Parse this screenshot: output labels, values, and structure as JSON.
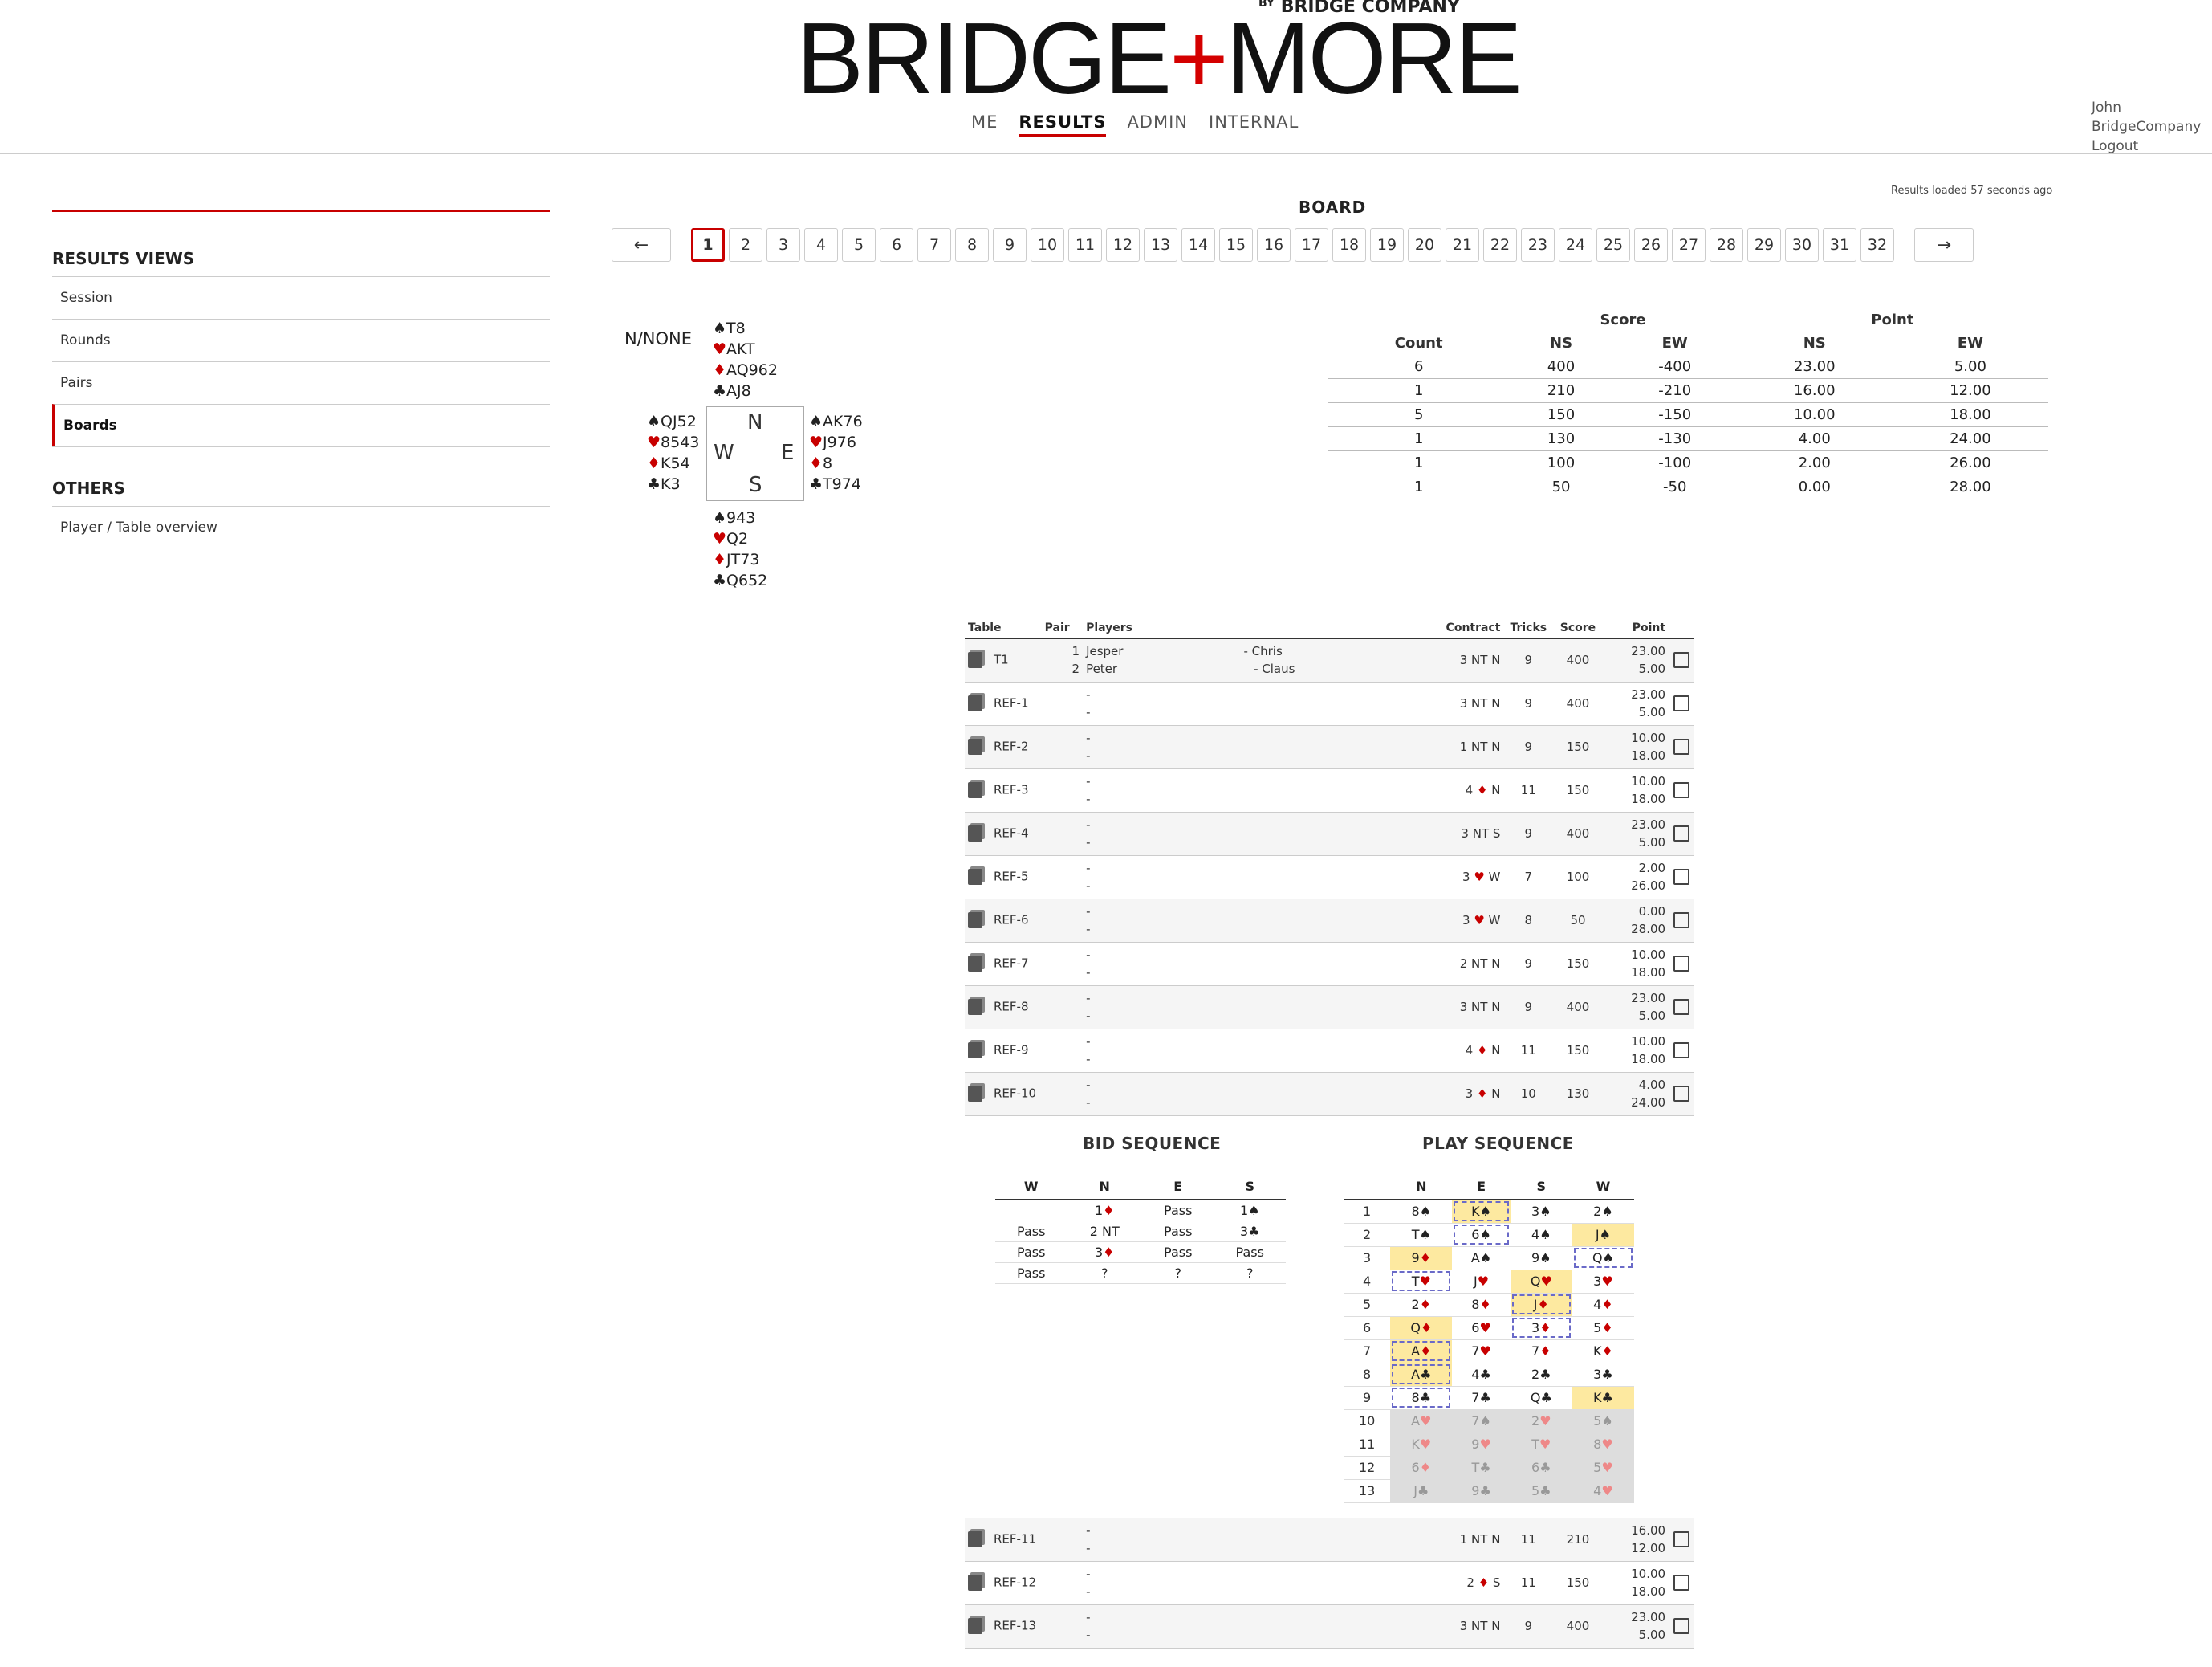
{
  "logo": {
    "text1": "BRIDGE",
    "plus": "+",
    "text2": "MORE",
    "by": "BY",
    "company": "BRIDGE COMPANY"
  },
  "nav": [
    "ME",
    "RESULTS",
    "ADMIN",
    "INTERNAL"
  ],
  "user": {
    "name": "John",
    "org": "BridgeCompany",
    "logout": "Logout"
  },
  "sidebar": {
    "results_title": "RESULTS VIEWS",
    "items": [
      "Session",
      "Rounds",
      "Pairs",
      "Boards"
    ],
    "others_title": "OTHERS",
    "others": [
      "Player / Table overview"
    ]
  },
  "loaded": "Results loaded 57 seconds ago",
  "board_title": "BOARD",
  "pager": {
    "prev": "←",
    "next": "→",
    "pages": [
      "1",
      "2",
      "3",
      "4",
      "5",
      "6",
      "7",
      "8",
      "9",
      "10",
      "11",
      "12",
      "13",
      "14",
      "15",
      "16",
      "17",
      "18",
      "19",
      "20",
      "21",
      "22",
      "23",
      "24",
      "25",
      "26",
      "27",
      "28",
      "29",
      "30",
      "31",
      "32"
    ]
  },
  "deal": {
    "dealer_vul": "N/NONE",
    "north": [
      "T8",
      "AKT",
      "AQ962",
      "AJ8"
    ],
    "west": [
      "QJ52",
      "8543",
      "K54",
      "K3"
    ],
    "east": [
      "AK76",
      "J976",
      "8",
      "T974"
    ],
    "south": [
      "943",
      "Q2",
      "JT73",
      "Q652"
    ],
    "compass": {
      "n": "N",
      "w": "W",
      "e": "E",
      "s": "S"
    }
  },
  "score_table": {
    "groups": [
      "Score",
      "Point"
    ],
    "headers": [
      "Count",
      "NS",
      "EW",
      "NS",
      "EW"
    ],
    "rows": [
      [
        "6",
        "400",
        "-400",
        "23.00",
        "5.00"
      ],
      [
        "1",
        "210",
        "-210",
        "16.00",
        "12.00"
      ],
      [
        "5",
        "150",
        "-150",
        "10.00",
        "18.00"
      ],
      [
        "1",
        "130",
        "-130",
        "4.00",
        "24.00"
      ],
      [
        "1",
        "100",
        "-100",
        "2.00",
        "26.00"
      ],
      [
        "1",
        "50",
        "-50",
        "0.00",
        "28.00"
      ]
    ]
  },
  "results": {
    "headers": [
      "Table",
      "Pair",
      "Players",
      "Contract",
      "Tricks",
      "Score",
      "Point"
    ],
    "rows": [
      {
        "table": "T1",
        "pair1": "1",
        "pair2": "2",
        "p1": "Jesper",
        "p1b": "- Chris",
        "p2": "Peter",
        "p2b": "- Claus",
        "level": "3",
        "suit": "NT",
        "decl": "N",
        "tricks": "9",
        "score": "400",
        "pt1": "23.00",
        "pt2": "5.00"
      },
      {
        "table": "REF-1",
        "pair1": "",
        "pair2": "",
        "p1": "-",
        "p1b": "",
        "p2": "-",
        "p2b": "",
        "level": "3",
        "suit": "NT",
        "decl": "N",
        "tricks": "9",
        "score": "400",
        "pt1": "23.00",
        "pt2": "5.00"
      },
      {
        "table": "REF-2",
        "pair1": "",
        "pair2": "",
        "p1": "-",
        "p1b": "",
        "p2": "-",
        "p2b": "",
        "level": "1",
        "suit": "NT",
        "decl": "N",
        "tricks": "9",
        "score": "150",
        "pt1": "10.00",
        "pt2": "18.00"
      },
      {
        "table": "REF-3",
        "pair1": "",
        "pair2": "",
        "p1": "-",
        "p1b": "",
        "p2": "-",
        "p2b": "",
        "level": "4",
        "suit": "♦",
        "decl": "N",
        "tricks": "11",
        "score": "150",
        "pt1": "10.00",
        "pt2": "18.00"
      },
      {
        "table": "REF-4",
        "pair1": "",
        "pair2": "",
        "p1": "-",
        "p1b": "",
        "p2": "-",
        "p2b": "",
        "level": "3",
        "suit": "NT",
        "decl": "S",
        "tricks": "9",
        "score": "400",
        "pt1": "23.00",
        "pt2": "5.00"
      },
      {
        "table": "REF-5",
        "pair1": "",
        "pair2": "",
        "p1": "-",
        "p1b": "",
        "p2": "-",
        "p2b": "",
        "level": "3",
        "suit": "♥",
        "decl": "W",
        "tricks": "7",
        "score": "100",
        "pt1": "2.00",
        "pt2": "26.00"
      },
      {
        "table": "REF-6",
        "pair1": "",
        "pair2": "",
        "p1": "-",
        "p1b": "",
        "p2": "-",
        "p2b": "",
        "level": "3",
        "suit": "♥",
        "decl": "W",
        "tricks": "8",
        "score": "50",
        "pt1": "0.00",
        "pt2": "28.00"
      },
      {
        "table": "REF-7",
        "pair1": "",
        "pair2": "",
        "p1": "-",
        "p1b": "",
        "p2": "-",
        "p2b": "",
        "level": "2",
        "suit": "NT",
        "decl": "N",
        "tricks": "9",
        "score": "150",
        "pt1": "10.00",
        "pt2": "18.00"
      },
      {
        "table": "REF-8",
        "pair1": "",
        "pair2": "",
        "p1": "-",
        "p1b": "",
        "p2": "-",
        "p2b": "",
        "level": "3",
        "suit": "NT",
        "decl": "N",
        "tricks": "9",
        "score": "400",
        "pt1": "23.00",
        "pt2": "5.00"
      },
      {
        "table": "REF-9",
        "pair1": "",
        "pair2": "",
        "p1": "-",
        "p1b": "",
        "p2": "-",
        "p2b": "",
        "level": "4",
        "suit": "♦",
        "decl": "N",
        "tricks": "11",
        "score": "150",
        "pt1": "10.00",
        "pt2": "18.00"
      },
      {
        "table": "REF-10",
        "pair1": "",
        "pair2": "",
        "p1": "-",
        "p1b": "",
        "p2": "-",
        "p2b": "",
        "level": "3",
        "suit": "♦",
        "decl": "N",
        "tricks": "10",
        "score": "130",
        "pt1": "4.00",
        "pt2": "24.00"
      }
    ],
    "rows_after": [
      {
        "table": "REF-11",
        "pair1": "",
        "pair2": "",
        "p1": "-",
        "p1b": "",
        "p2": "-",
        "p2b": "",
        "level": "1",
        "suit": "NT",
        "decl": "N",
        "tricks": "11",
        "score": "210",
        "pt1": "16.00",
        "pt2": "12.00"
      },
      {
        "table": "REF-12",
        "pair1": "",
        "pair2": "",
        "p1": "-",
        "p1b": "",
        "p2": "-",
        "p2b": "",
        "level": "2",
        "suit": "♦",
        "decl": "S",
        "tricks": "11",
        "score": "150",
        "pt1": "10.00",
        "pt2": "18.00"
      },
      {
        "table": "REF-13",
        "pair1": "",
        "pair2": "",
        "p1": "-",
        "p1b": "",
        "p2": "-",
        "p2b": "",
        "level": "3",
        "suit": "NT",
        "decl": "N",
        "tricks": "9",
        "score": "400",
        "pt1": "23.00",
        "pt2": "5.00"
      }
    ]
  },
  "bid_sequence": {
    "title": "BID SEQUENCE",
    "headers": [
      "W",
      "N",
      "E",
      "S"
    ],
    "rows": [
      [
        "",
        "1♦",
        "Pass",
        "1♠"
      ],
      [
        "Pass",
        "2 NT",
        "Pass",
        "3♣"
      ],
      [
        "Pass",
        "3♦",
        "Pass",
        "Pass"
      ],
      [
        "Pass",
        "?",
        "?",
        "?"
      ]
    ]
  },
  "play_sequence": {
    "title": "PLAY SEQUENCE",
    "headers": [
      "",
      "N",
      "E",
      "S",
      "W"
    ],
    "rows": [
      {
        "n": "1",
        "c": [
          "8♠",
          "K♠",
          "3♠",
          "2♠"
        ],
        "win": 1,
        "lead": 1,
        "grey": false
      },
      {
        "n": "2",
        "c": [
          "T♠",
          "6♠",
          "4♠",
          "J♠"
        ],
        "win": 3,
        "lead": 1,
        "grey": false
      },
      {
        "n": "3",
        "c": [
          "9♦",
          "A♠",
          "9♠",
          "Q♠"
        ],
        "win": 0,
        "lead": 3,
        "grey": false
      },
      {
        "n": "4",
        "c": [
          "T♥",
          "J♥",
          "Q♥",
          "3♥"
        ],
        "win": 2,
        "lead": 0,
        "grey": false
      },
      {
        "n": "5",
        "c": [
          "2♦",
          "8♦",
          "J♦",
          "4♦"
        ],
        "win": 2,
        "lead": 2,
        "grey": false
      },
      {
        "n": "6",
        "c": [
          "Q♦",
          "6♥",
          "3♦",
          "5♦"
        ],
        "win": 0,
        "lead": 2,
        "grey": false
      },
      {
        "n": "7",
        "c": [
          "A♦",
          "7♥",
          "7♦",
          "K♦"
        ],
        "win": 0,
        "lead": 0,
        "grey": false
      },
      {
        "n": "8",
        "c": [
          "A♣",
          "4♣",
          "2♣",
          "3♣"
        ],
        "win": 0,
        "lead": 0,
        "grey": false
      },
      {
        "n": "9",
        "c": [
          "8♣",
          "7♣",
          "Q♣",
          "K♣"
        ],
        "win": 3,
        "lead": 0,
        "grey": false
      },
      {
        "n": "10",
        "c": [
          "A♥",
          "7♠",
          "2♥",
          "5♠"
        ],
        "win": -1,
        "lead": -1,
        "grey": true
      },
      {
        "n": "11",
        "c": [
          "K♥",
          "9♥",
          "T♥",
          "8♥"
        ],
        "win": -1,
        "lead": -1,
        "grey": true
      },
      {
        "n": "12",
        "c": [
          "6♦",
          "T♣",
          "6♣",
          "5♥"
        ],
        "win": -1,
        "lead": -1,
        "grey": true
      },
      {
        "n": "13",
        "c": [
          "J♣",
          "9♣",
          "5♣",
          "4♥"
        ],
        "win": -1,
        "lead": -1,
        "grey": true
      }
    ]
  },
  "colors": {
    "accent": "#c80000",
    "winner": "#fde9a0",
    "lead_outline": "#6a6ac8"
  }
}
